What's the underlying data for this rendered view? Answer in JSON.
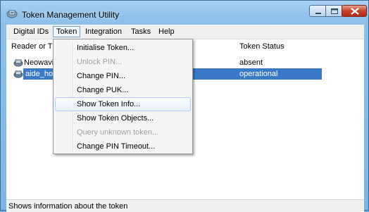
{
  "window": {
    "title": "Token Management Utility"
  },
  "menubar": [
    {
      "label": "Digital IDs"
    },
    {
      "label": "Token"
    },
    {
      "label": "Integration"
    },
    {
      "label": "Tasks"
    },
    {
      "label": "Help"
    }
  ],
  "list": {
    "columns": [
      "Reader or T",
      "Token Status"
    ],
    "rows": [
      {
        "reader": "Neowavi",
        "status": "absent",
        "selected": false
      },
      {
        "reader": "aide_hol",
        "status": "operational",
        "selected": true
      }
    ]
  },
  "token_menu": [
    {
      "label": "Initialise Token...",
      "enabled": true
    },
    {
      "label": "Unlock PIN...",
      "enabled": false
    },
    {
      "label": "Change PIN...",
      "enabled": true
    },
    {
      "label": "Change PUK...",
      "enabled": true
    },
    {
      "label": "Show Token Info...",
      "enabled": true,
      "hover": true
    },
    {
      "label": "Show Token Objects...",
      "enabled": true
    },
    {
      "label": "Query unknown token...",
      "enabled": false
    },
    {
      "label": "Change PIN Timeout...",
      "enabled": true
    }
  ],
  "statusbar": {
    "text": "Shows information about the token"
  }
}
